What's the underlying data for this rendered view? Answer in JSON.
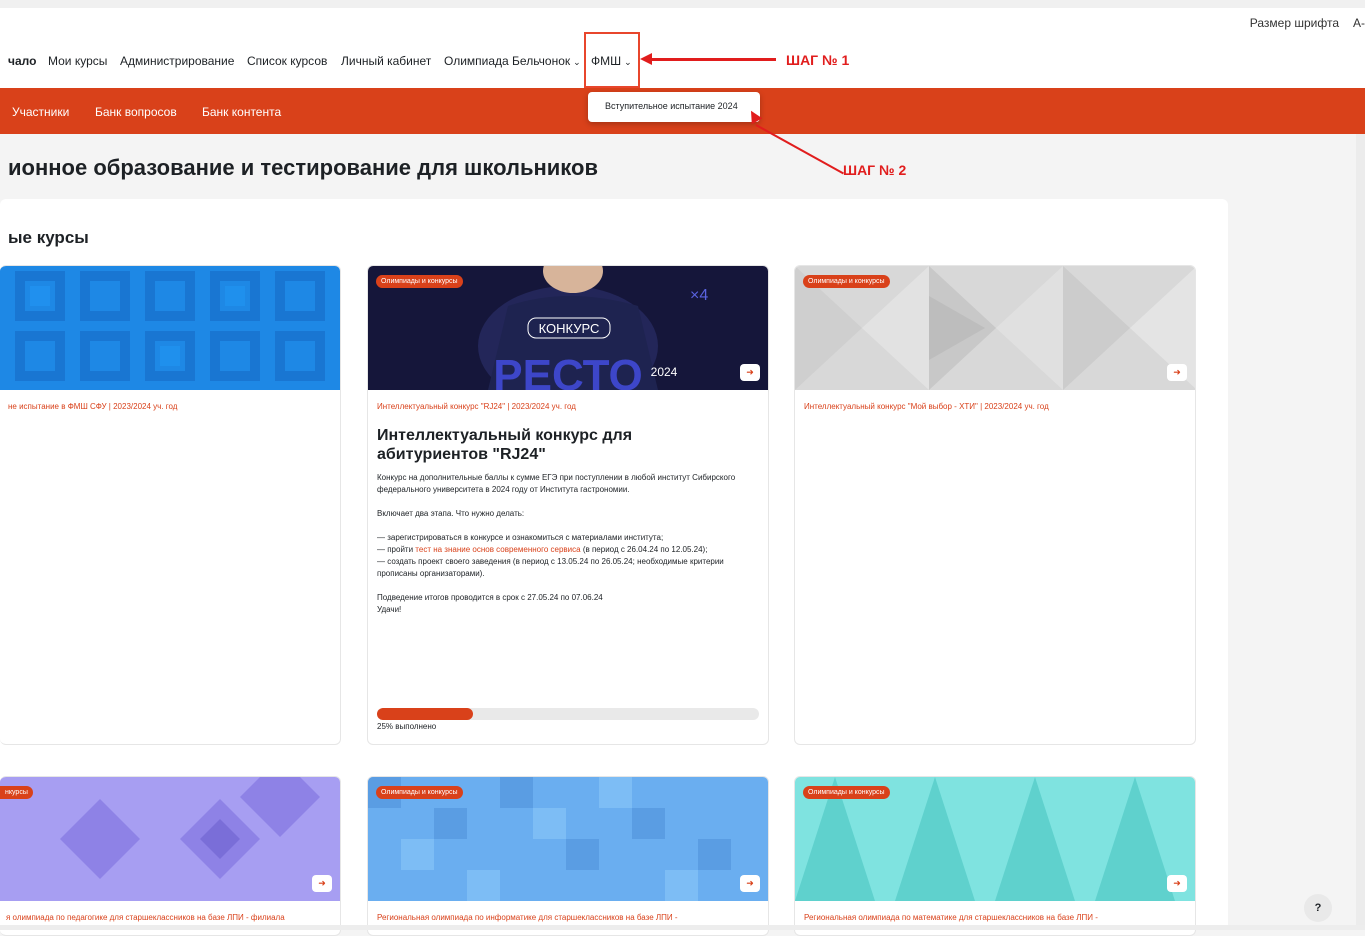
{
  "header": {
    "font_size_label": "Размер шрифта",
    "font_size_control": "A-"
  },
  "primary_nav": {
    "items": [
      "чало",
      "Мои курсы",
      "Администрирование",
      "Список курсов",
      "Личный кабинет",
      "Олимпиада Бельчонок",
      "ФМШ"
    ]
  },
  "annotations": {
    "step1": "ШАГ № 1",
    "step2": "ШАГ № 2"
  },
  "dropdown": {
    "item": "Вступительное испытание 2024"
  },
  "secondary_nav": {
    "items": [
      "Участники",
      "Банк вопросов",
      "Банк контента"
    ]
  },
  "page": {
    "title": "ионное образование и тестирование для школьников",
    "section_title": "ые курсы"
  },
  "cards": [
    {
      "category": "не испытание в ФМШ СФУ | 2023/2024 уч. год",
      "badge": ""
    },
    {
      "badge": "Олимпиады и конкурсы",
      "image_text_top": "КОНКУРС",
      "image_text_big": "РЕСТО",
      "image_year": "2024",
      "category": "Интеллектуальный конкурс \"RJ24\" | 2023/2024 уч. год",
      "title": "Интеллектуальный конкурс для абитуриентов \"RJ24\"",
      "desc1": "Конкурс на дополнительные баллы к сумме ЕГЭ при поступлении в любой институт Сибирского федерального университета в 2024 году от Института гастрономии.",
      "desc2": "Включает два этапа. Что нужно делать:",
      "desc3a": "— зарегистрироваться в конкурсе и ознакомиться с материалами института;",
      "desc3b_pre": "— пройти",
      "desc3b_link": "тест на знание основ современного сервиса",
      "desc3b_post": "(в период с 26.04.24 по 12.05.24);",
      "desc3c": "— создать проект своего заведения (в период с 13.05.24 по 26.05.24; необходимые критерии прописаны организаторами).",
      "desc4a": "Подведение итогов проводится в срок с 27.05.24 по 07.06.24",
      "desc4b": "Удачи!",
      "progress_label": "25% выполнено",
      "progress": 0.25
    },
    {
      "badge": "Олимпиады и конкурсы",
      "category": "Интеллектуальный конкурс \"Мой выбор - ХТИ\" | 2023/2024 уч. год"
    },
    {
      "badge": "нкурсы",
      "category": "я олимпиада по педагогике для старшеклассников на базе ЛПИ - филиала"
    },
    {
      "badge": "Олимпиады и конкурсы",
      "category": "Региональная олимпиада по информатике для старшеклассников на базе ЛПИ -"
    },
    {
      "badge": "Олимпиады и конкурсы",
      "category": "Региональная олимпиада по математике для старшеклассников на базе ЛПИ -"
    }
  ],
  "help": "?",
  "colors": {
    "brand": "#d9411a",
    "annotation": "#e11d1d"
  }
}
